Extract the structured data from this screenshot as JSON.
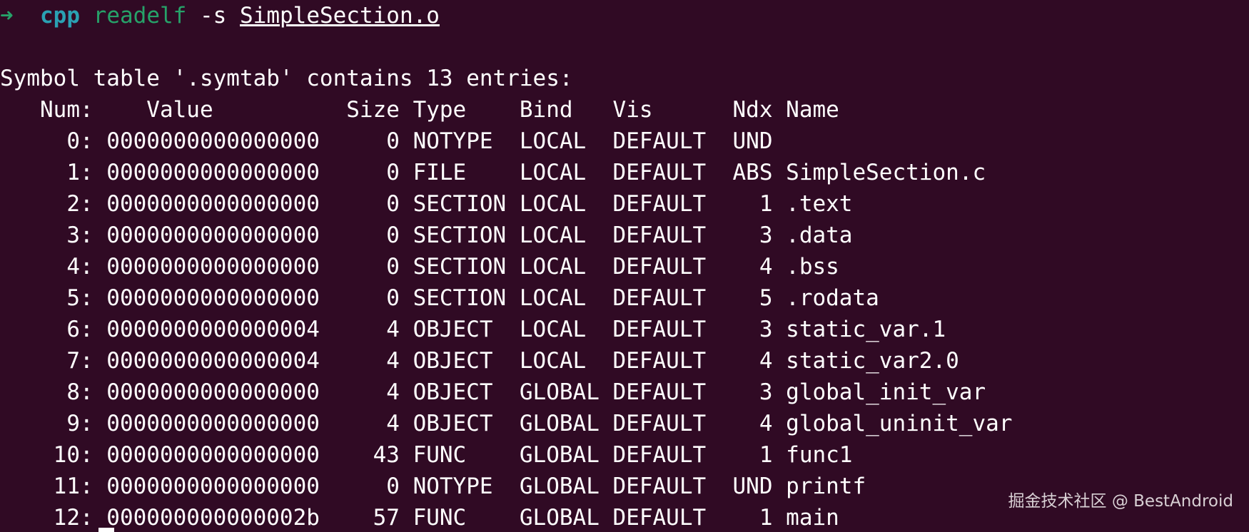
{
  "prompt": {
    "arrow": "➜",
    "directory": "cpp",
    "command": "readelf",
    "option": "-s",
    "file": "SimpleSection.o"
  },
  "symtab_summary": "Symbol table '.symtab' contains 13 entries:",
  "table": {
    "header": "   Num:    Value          Size Type    Bind   Vis      Ndx Name",
    "rows": [
      "     0: 0000000000000000     0 NOTYPE  LOCAL  DEFAULT  UND ",
      "     1: 0000000000000000     0 FILE    LOCAL  DEFAULT  ABS SimpleSection.c",
      "     2: 0000000000000000     0 SECTION LOCAL  DEFAULT    1 .text",
      "     3: 0000000000000000     0 SECTION LOCAL  DEFAULT    3 .data",
      "     4: 0000000000000000     0 SECTION LOCAL  DEFAULT    4 .bss",
      "     5: 0000000000000000     0 SECTION LOCAL  DEFAULT    5 .rodata",
      "     6: 0000000000000004     4 OBJECT  LOCAL  DEFAULT    3 static_var.1",
      "     7: 0000000000000004     4 OBJECT  LOCAL  DEFAULT    4 static_var2.0",
      "     8: 0000000000000000     4 OBJECT  GLOBAL DEFAULT    3 global_init_var",
      "     9: 0000000000000000     4 OBJECT  GLOBAL DEFAULT    4 global_uninit_var",
      "    10: 0000000000000000    43 FUNC    GLOBAL DEFAULT    1 func1",
      "    11: 0000000000000000     0 NOTYPE  GLOBAL DEFAULT  UND printf",
      "    12: 000000000000002b    57 FUNC    GLOBAL DEFAULT    1 main"
    ]
  },
  "watermark": "掘金技术社区 @ BestAndroid",
  "colors": {
    "background": "#300a24",
    "prompt_arrow": "#26a269",
    "prompt_dir": "#2aa1b3",
    "command": "#26a269",
    "text": "#ffffff"
  }
}
